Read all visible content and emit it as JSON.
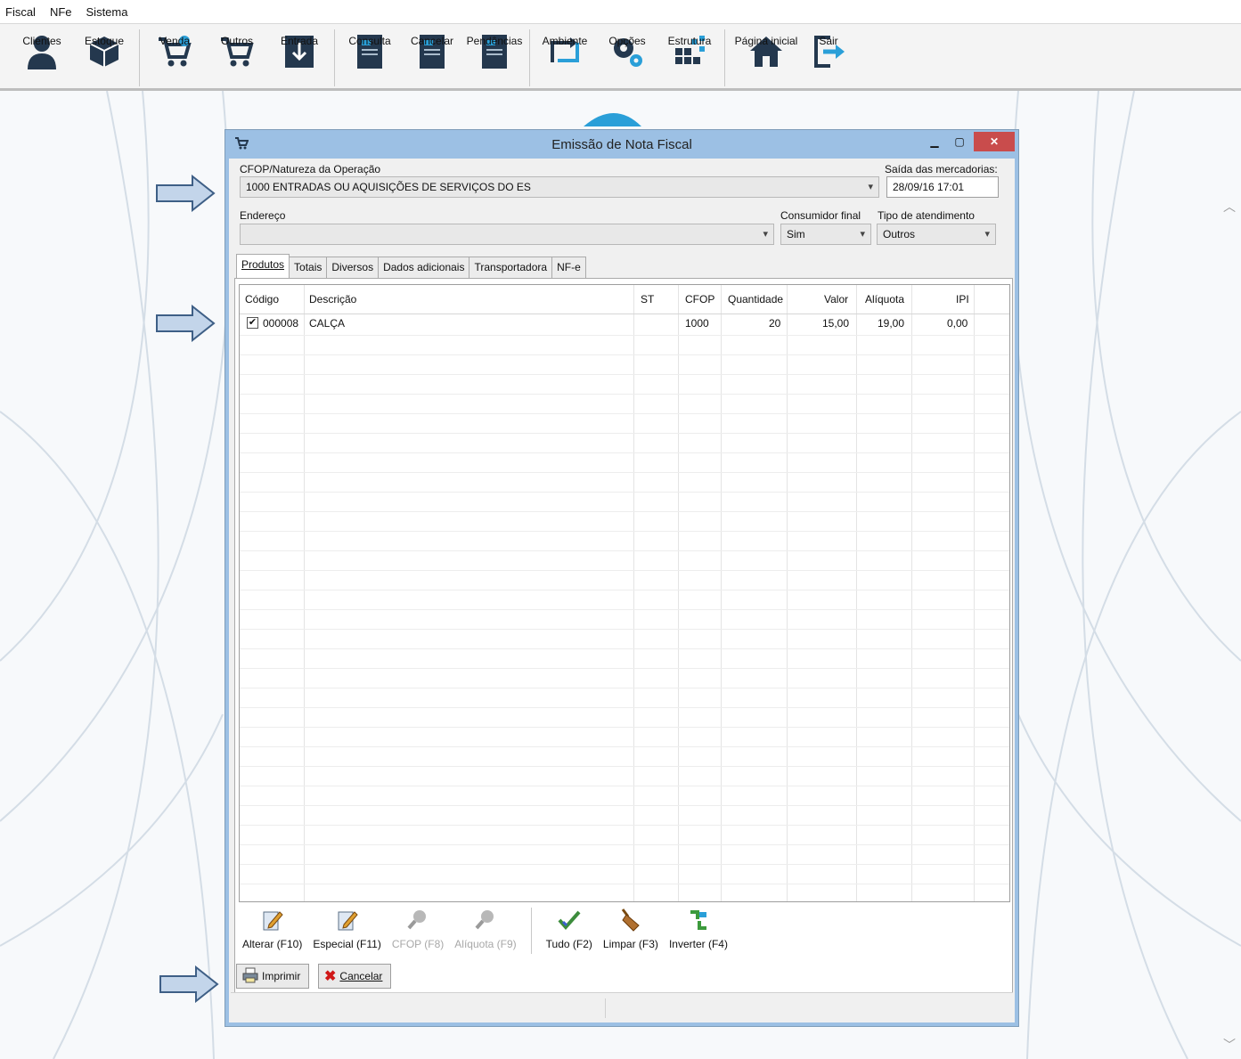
{
  "menu": [
    "Fiscal",
    "NFe",
    "Sistema"
  ],
  "toolbar": [
    {
      "label": "Clientes",
      "icon": "user-icon"
    },
    {
      "label": "Estoque",
      "icon": "box-icon"
    },
    {
      "label": "Venda",
      "icon": "cart-add-icon"
    },
    {
      "label": "Outros",
      "icon": "cart-icon"
    },
    {
      "label": "Entrada",
      "icon": "download-box-icon"
    },
    {
      "label": "Consulta",
      "icon": "document-search-icon"
    },
    {
      "label": "Cancelar",
      "icon": "document-cancel-icon"
    },
    {
      "label": "Pendências",
      "icon": "document-pending-icon"
    },
    {
      "label": "Ambiente",
      "icon": "switch-arrows-icon"
    },
    {
      "label": "Opções",
      "icon": "gears-icon"
    },
    {
      "label": "Estrutura",
      "icon": "structure-icon"
    },
    {
      "label": "Página inicial",
      "icon": "home-icon"
    },
    {
      "label": "Sair",
      "icon": "exit-icon"
    }
  ],
  "dialog": {
    "title": "Emissão de Nota Fiscal",
    "cfop_label": "CFOP/Natureza da Operação",
    "cfop_value": "1000 ENTRADAS OU AQUISIÇÕES DE SERVIÇOS DO ES",
    "saida_label": "Saída das mercadorias:",
    "saida_value": "28/09/16 17:01",
    "endereco_label": "Endereço",
    "endereco_value": "",
    "consumidor_label": "Consumidor final",
    "consumidor_value": "Sim",
    "tipo_label": "Tipo de atendimento",
    "tipo_value": "Outros",
    "tabs": [
      "Produtos",
      "Totais",
      "Diversos",
      "Dados adicionais",
      "Transportadora",
      "NF-e"
    ],
    "grid": {
      "columns": [
        "Código",
        "Descrição",
        "ST",
        "CFOP",
        "Quantidade",
        "Valor",
        "Alíquota",
        "IPI"
      ],
      "rows": [
        {
          "checked": true,
          "codigo": "000008",
          "descricao": "CALÇA",
          "st": "",
          "cfop": "1000",
          "quantidade": "20",
          "valor": "15,00",
          "aliquota": "19,00",
          "ipi": "0,00"
        }
      ]
    },
    "actions": [
      {
        "label": "Alterar (F10)",
        "icon": "edit-icon",
        "enabled": true
      },
      {
        "label": "Especial (F11)",
        "icon": "edit-special-icon",
        "enabled": true
      },
      {
        "label": "CFOP (F8)",
        "icon": "magnifier-icon",
        "enabled": false
      },
      {
        "label": "Alíquota (F9)",
        "icon": "magnifier-icon",
        "enabled": false
      },
      {
        "label": "Tudo (F2)",
        "icon": "check-icon",
        "enabled": true
      },
      {
        "label": "Limpar (F3)",
        "icon": "broom-icon",
        "enabled": true
      },
      {
        "label": "Inverter (F4)",
        "icon": "invert-icon",
        "enabled": true
      }
    ],
    "print_label": "Imprimir",
    "cancel_label": "Cancelar"
  }
}
